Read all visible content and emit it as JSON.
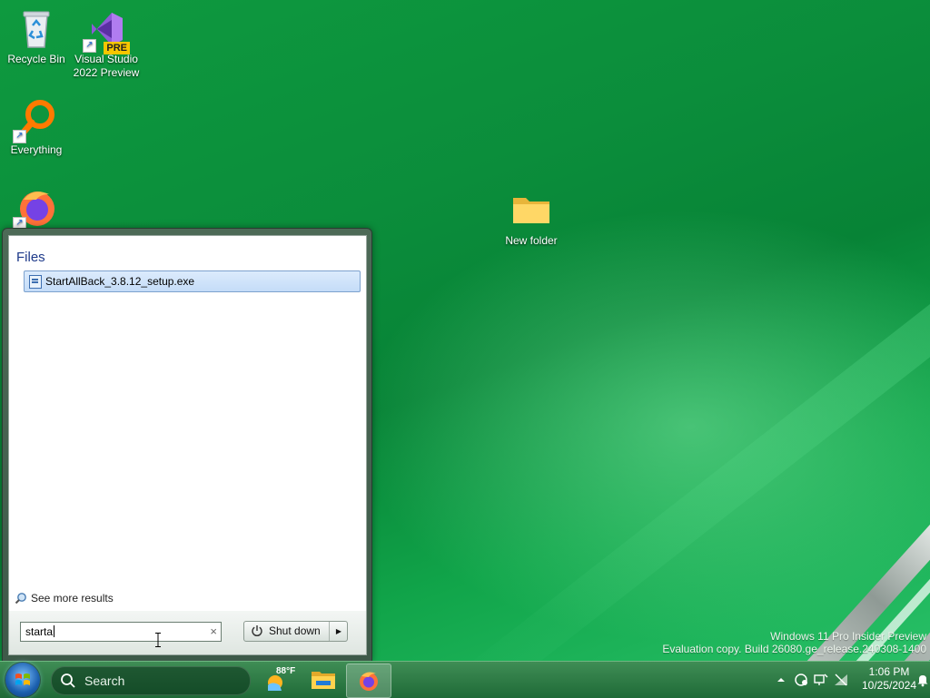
{
  "desktop": {
    "icons": [
      {
        "label": "Recycle Bin"
      },
      {
        "label": "Visual Studio 2022 Preview",
        "line1": "Visual Studio",
        "line2": "2022 Preview",
        "badge": "PRE"
      },
      {
        "label": "Everything"
      },
      {
        "label": "Firefox"
      },
      {
        "label": "New folder"
      }
    ],
    "watermark": {
      "line1": "Windows 11 Pro Insider Preview",
      "line2": "Evaluation copy. Build 26080.ge_release.240308-1400"
    }
  },
  "start_menu": {
    "section_heading": "Files",
    "results": [
      {
        "label": "StartAllBack_3.8.12_setup.exe",
        "icon": "installer-file-icon",
        "selected": true
      }
    ],
    "see_more": "See more results",
    "search": {
      "value": "starta",
      "clear_glyph": "×"
    },
    "shutdown": {
      "label": "Shut down",
      "arrow_glyph": "▶"
    }
  },
  "taskbar": {
    "search_label": "Search",
    "weather": {
      "temp": "88°F"
    },
    "apps": [
      {
        "name": "File Explorer",
        "icon": "folder-icon"
      },
      {
        "name": "Firefox",
        "icon": "firefox-icon",
        "active": true
      }
    ],
    "tray": {
      "time": "1:06 PM",
      "date": "10/25/2024"
    }
  },
  "colors": {
    "desktop_green": "#0a8a3a",
    "selection_fill": "#c4dcf8",
    "heading_blue": "#1e3a8a"
  }
}
